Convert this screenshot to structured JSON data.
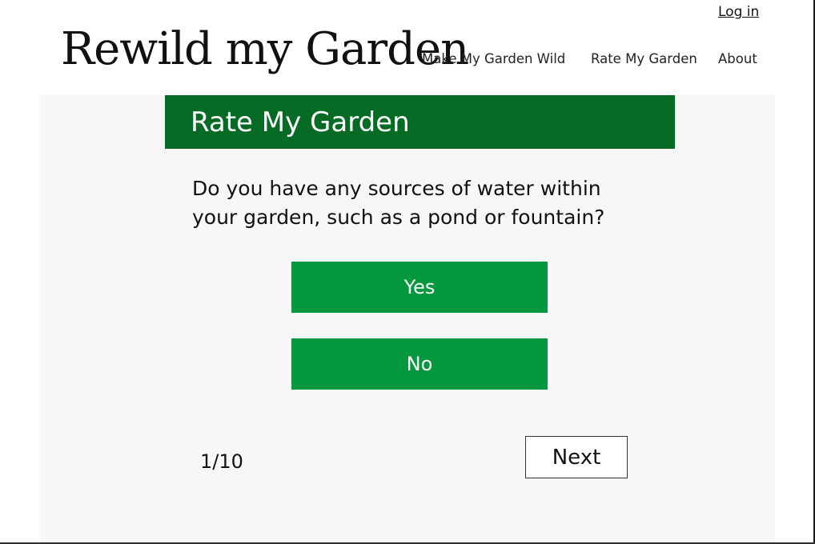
{
  "header": {
    "logo_text": "Rewild my Garden",
    "login_label": "Log in",
    "nav": {
      "make_wild": "Make My Garden Wild",
      "rate": "Rate My Garden",
      "about": "About"
    }
  },
  "quiz": {
    "title": "Rate My Garden",
    "question": "Do you have any sources of water within your garden, such as a pond or fountain?",
    "answers": {
      "yes": "Yes",
      "no": "No"
    },
    "progress": "1/10",
    "next_label": "Next"
  },
  "colors": {
    "banner": "#056b24",
    "answer_button": "#03983e",
    "panel": "#f7f7f7"
  }
}
